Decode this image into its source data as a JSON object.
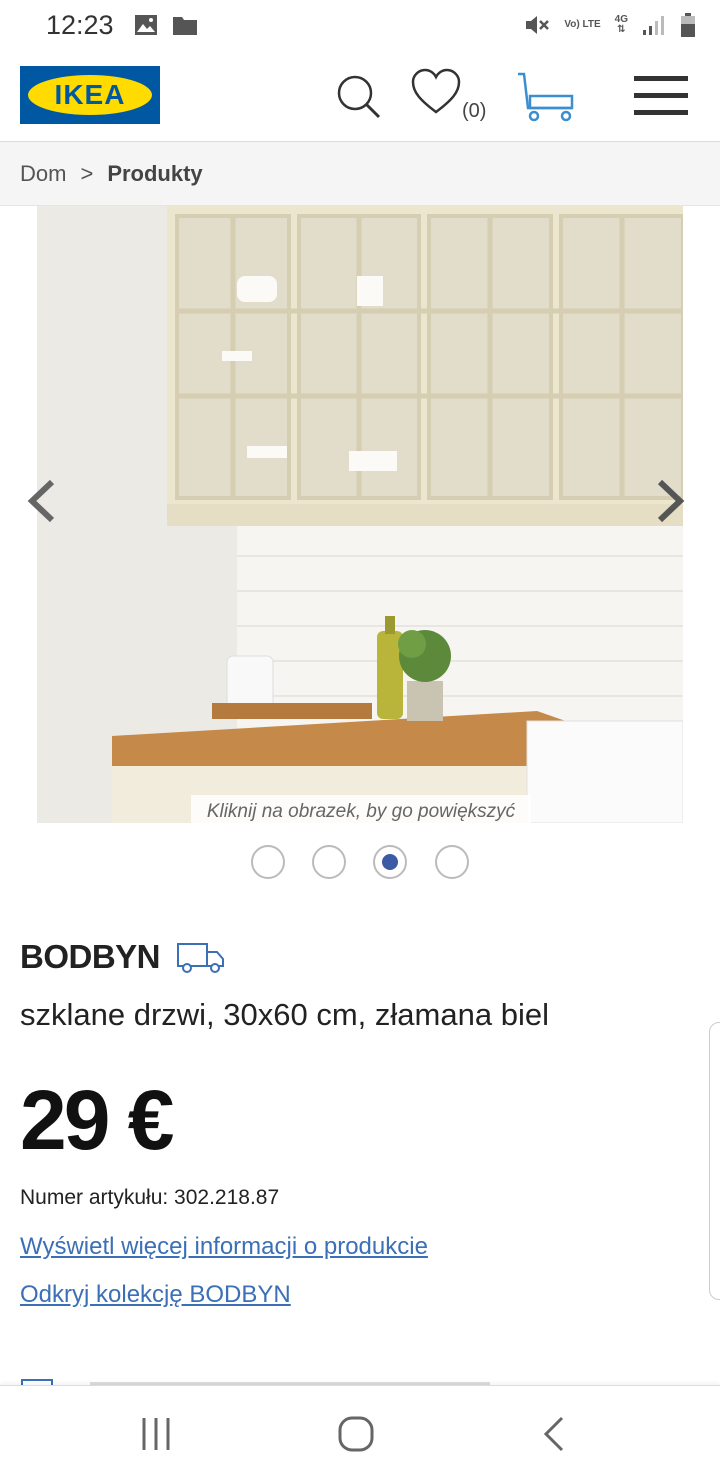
{
  "status_bar": {
    "time": "12:23",
    "network_top": "Vo) LTE",
    "network_gen": "4G"
  },
  "header": {
    "logo_text": "IKEA",
    "wishlist_count": "(0)"
  },
  "breadcrumb": {
    "items": [
      "Dom",
      "Produkty"
    ],
    "separator": ">"
  },
  "gallery": {
    "zoom_hint": "Kliknij na obrazek, by go powiększyć",
    "active_index": 2,
    "count": 4
  },
  "product": {
    "name": "BODBYN",
    "description": "szklane drzwi, 30x60 cm, złamana biel",
    "price": "29 €",
    "article_number": "Numer artykułu: 302.218.87",
    "link_more_info": "Wyświetl więcej informacji o produkcie",
    "link_collection": "Odkryj kolekcję BODBYN"
  },
  "colors": {
    "ikea_blue": "#0058a3",
    "ikea_yellow": "#ffdb00",
    "link_blue": "#3b6fb6",
    "active_dot": "#3b5ba5"
  }
}
